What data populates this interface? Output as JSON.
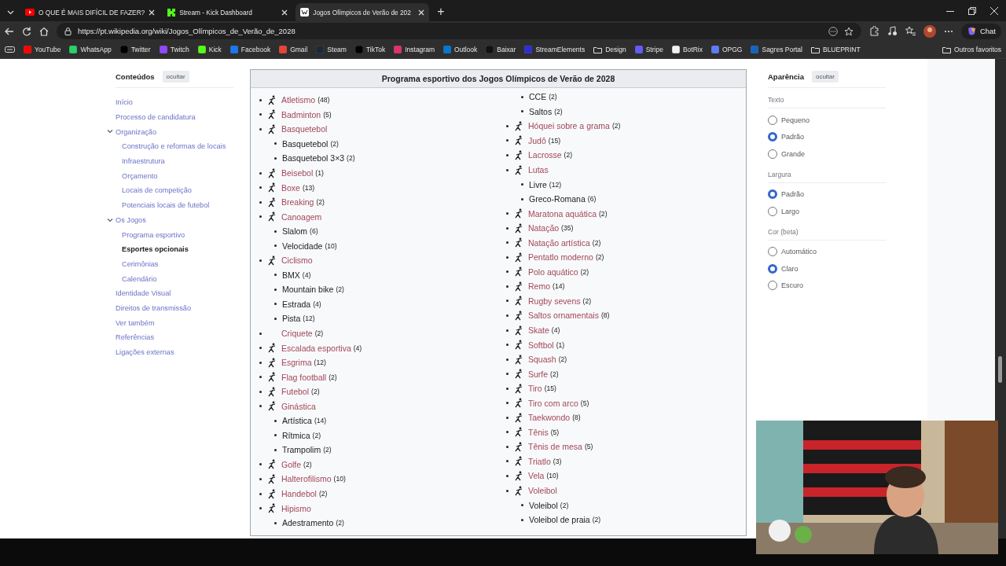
{
  "browser": {
    "tabs": [
      {
        "title": "O QUE É MAIS DIFÍCIL DE FAZER?",
        "kind": "video",
        "selected": false
      },
      {
        "title": "Stream - Kick Dashboard",
        "kind": "stream",
        "selected": false
      },
      {
        "title": "Jogos Olímpicos de Verão de 202",
        "kind": "wiki",
        "selected": true
      }
    ],
    "new_tab": "+",
    "url": "https://pt.wikipedia.org/wiki/Jogos_Olímpicos_de_Verão_de_2028",
    "chat_button": "Chat",
    "bookmarks": [
      {
        "label": "YouTube",
        "kind": "site",
        "color": "#ff0000"
      },
      {
        "label": "WhatsApp",
        "kind": "site",
        "color": "#25d366"
      },
      {
        "label": "Twitter",
        "kind": "site",
        "color": "#000000"
      },
      {
        "label": "Twitch",
        "kind": "site",
        "color": "#9146ff"
      },
      {
        "label": "Kick",
        "kind": "site",
        "color": "#53fc18"
      },
      {
        "label": "Facebook",
        "kind": "site",
        "color": "#1877f2"
      },
      {
        "label": "Gmail",
        "kind": "site",
        "color": "#ea4335"
      },
      {
        "label": "Steam",
        "kind": "site",
        "color": "#1b2838"
      },
      {
        "label": "TikTok",
        "kind": "site",
        "color": "#010101"
      },
      {
        "label": "Instagram",
        "kind": "site",
        "color": "#e1306c"
      },
      {
        "label": "Outlook",
        "kind": "site",
        "color": "#0078d4"
      },
      {
        "label": "Baixar",
        "kind": "site",
        "color": "#111111"
      },
      {
        "label": "StreamElements",
        "kind": "site",
        "color": "#2d2dd8"
      },
      {
        "label": "Design",
        "kind": "folder"
      },
      {
        "label": "Stripe",
        "kind": "site",
        "color": "#635bff"
      },
      {
        "label": "BotRix",
        "kind": "site",
        "color": "#f2f2f2"
      },
      {
        "label": "OPGG",
        "kind": "site",
        "color": "#5c7cfa"
      },
      {
        "label": "Sagres Portal",
        "kind": "site",
        "color": "#1565c0"
      },
      {
        "label": "BLUEPRINT",
        "kind": "folder"
      }
    ],
    "other_bookmarks": {
      "label": "Outros favoritos",
      "kind": "folder"
    }
  },
  "toc": {
    "title": "Conteúdos",
    "hide_button": "ocultar",
    "items": [
      {
        "label": "Início",
        "selected": false
      },
      {
        "label": "Processo de candidatura",
        "selected": false
      },
      {
        "label": "Organização",
        "selected": false,
        "expanded": true,
        "children": [
          {
            "label": "Construção e reformas de locais",
            "selected": false
          },
          {
            "label": "Infraestrutura",
            "selected": false
          },
          {
            "label": "Orçamento",
            "selected": false
          },
          {
            "label": "Locais de competição",
            "selected": false
          },
          {
            "label": "Potenciais locais de futebol",
            "selected": false
          }
        ]
      },
      {
        "label": "Os Jogos",
        "selected": false,
        "expanded": true,
        "children": [
          {
            "label": "Programa esportivo",
            "selected": false
          },
          {
            "label": "Esportes opcionais",
            "selected": true
          },
          {
            "label": "Cerimônias",
            "selected": false
          },
          {
            "label": "Calendário",
            "selected": false
          }
        ]
      },
      {
        "label": "Identidade Visual",
        "selected": false
      },
      {
        "label": "Direitos de transmissão",
        "selected": false
      },
      {
        "label": "Ver também",
        "selected": false
      },
      {
        "label": "Referências",
        "selected": false
      },
      {
        "label": "Ligações externas",
        "selected": false
      }
    ]
  },
  "infobox": {
    "title": "Programa esportivo dos Jogos Olímpicos de Verão de 2028",
    "columns": [
      [
        {
          "name": "Atletismo",
          "count": "(48)",
          "pictogram": true
        },
        {
          "name": "Badminton",
          "count": "(5)",
          "pictogram": true
        },
        {
          "name": "Basquetebol",
          "pictogram": true,
          "children": [
            {
              "name": "Basquetebol",
              "count": "(2)"
            },
            {
              "name": "Basquetebol 3×3",
              "count": "(2)"
            }
          ]
        },
        {
          "name": "Beisebol",
          "count": "(1)",
          "pictogram": true
        },
        {
          "name": "Boxe",
          "count": "(13)",
          "pictogram": true
        },
        {
          "name": "Breaking",
          "count": "(2)",
          "pictogram": true
        },
        {
          "name": "Canoagem",
          "pictogram": true,
          "children": [
            {
              "name": "Slalom",
              "count": "(6)"
            },
            {
              "name": "Velocidade",
              "count": "(10)"
            }
          ]
        },
        {
          "name": "Ciclismo",
          "pictogram": true,
          "children": [
            {
              "name": "BMX",
              "count": "(4)"
            },
            {
              "name": "Mountain bike",
              "count": "(2)"
            },
            {
              "name": "Estrada",
              "count": "(4)"
            },
            {
              "name": "Pista",
              "count": "(12)"
            }
          ]
        },
        {
          "name": "Criquete",
          "count": "(2)",
          "pictogram": false
        },
        {
          "name": "Escalada esportiva",
          "count": "(4)",
          "pictogram": true
        },
        {
          "name": "Esgrima",
          "count": "(12)",
          "pictogram": true
        },
        {
          "name": "Flag football",
          "count": "(2)",
          "pictogram": true
        },
        {
          "name": "Futebol",
          "count": "(2)",
          "pictogram": true
        },
        {
          "name": "Ginástica",
          "pictogram": true,
          "children": [
            {
              "name": "Artística",
              "count": "(14)"
            },
            {
              "name": "Rítmica",
              "count": "(2)"
            },
            {
              "name": "Trampolim",
              "count": "(2)"
            }
          ]
        },
        {
          "name": "Golfe",
          "count": "(2)",
          "pictogram": true
        },
        {
          "name": "Halterofilismo",
          "count": "(10)",
          "pictogram": true
        },
        {
          "name": "Handebol",
          "count": "(2)",
          "pictogram": true
        },
        {
          "name": "Hipismo",
          "pictogram": true,
          "children": [
            {
              "name": "Adestramento",
              "count": "(2)"
            }
          ]
        }
      ],
      [
        {
          "children": [
            {
              "name": "CCE",
              "count": "(2)"
            },
            {
              "name": "Saltos",
              "count": "(2)"
            }
          ]
        },
        {
          "name": "Hóquei sobre a grama",
          "count": "(2)",
          "pictogram": true
        },
        {
          "name": "Judô",
          "count": "(15)",
          "pictogram": true
        },
        {
          "name": "Lacrosse",
          "count": "(2)",
          "pictogram": true
        },
        {
          "name": "Lutas",
          "pictogram": true,
          "children": [
            {
              "name": "Livre",
              "count": "(12)"
            },
            {
              "name": "Greco-Romana",
              "count": "(6)"
            }
          ]
        },
        {
          "name": "Maratona aquática",
          "count": "(2)",
          "pictogram": true
        },
        {
          "name": "Natação",
          "count": "(35)",
          "pictogram": true
        },
        {
          "name": "Natação artística",
          "count": "(2)",
          "pictogram": true
        },
        {
          "name": "Pentatlo moderno",
          "count": "(2)",
          "pictogram": true
        },
        {
          "name": "Polo aquático",
          "count": "(2)",
          "pictogram": true
        },
        {
          "name": "Remo",
          "count": "(14)",
          "pictogram": true
        },
        {
          "name": "Rugby sevens",
          "count": "(2)",
          "pictogram": true
        },
        {
          "name": "Saltos ornamentais",
          "count": "(8)",
          "pictogram": true
        },
        {
          "name": "Skate",
          "count": "(4)",
          "pictogram": true
        },
        {
          "name": "Softbol",
          "count": "(1)",
          "pictogram": true
        },
        {
          "name": "Squash",
          "count": "(2)",
          "pictogram": true
        },
        {
          "name": "Surfe",
          "count": "(2)",
          "pictogram": true
        },
        {
          "name": "Tiro",
          "count": "(15)",
          "pictogram": true
        },
        {
          "name": "Tiro com arco",
          "count": "(5)",
          "pictogram": true
        },
        {
          "name": "Taekwondo",
          "count": "(8)",
          "pictogram": true
        },
        {
          "name": "Tênis",
          "count": "(5)",
          "pictogram": true
        },
        {
          "name": "Tênis de mesa",
          "count": "(5)",
          "pictogram": true
        },
        {
          "name": "Triatlo",
          "count": "(3)",
          "pictogram": true
        },
        {
          "name": "Vela",
          "count": "(10)",
          "pictogram": true
        },
        {
          "name": "Voleibol",
          "pictogram": true,
          "children": [
            {
              "name": "Voleibol",
              "count": "(2)"
            },
            {
              "name": "Voleibol de praia",
              "count": "(2)"
            }
          ]
        }
      ]
    ]
  },
  "appearance": {
    "title": "Aparência",
    "hide_button": "ocultar",
    "groups": [
      {
        "label": "Texto",
        "options": [
          {
            "label": "Pequeno",
            "selected": false
          },
          {
            "label": "Padrão",
            "selected": true
          },
          {
            "label": "Grande",
            "selected": false
          }
        ]
      },
      {
        "label": "Largura",
        "options": [
          {
            "label": "Padrão",
            "selected": true
          },
          {
            "label": "Largo",
            "selected": false
          }
        ]
      },
      {
        "label": "Cor (beta)",
        "options": [
          {
            "label": "Automático",
            "selected": false
          },
          {
            "label": "Claro",
            "selected": true
          },
          {
            "label": "Escuro",
            "selected": false
          }
        ]
      }
    ]
  }
}
